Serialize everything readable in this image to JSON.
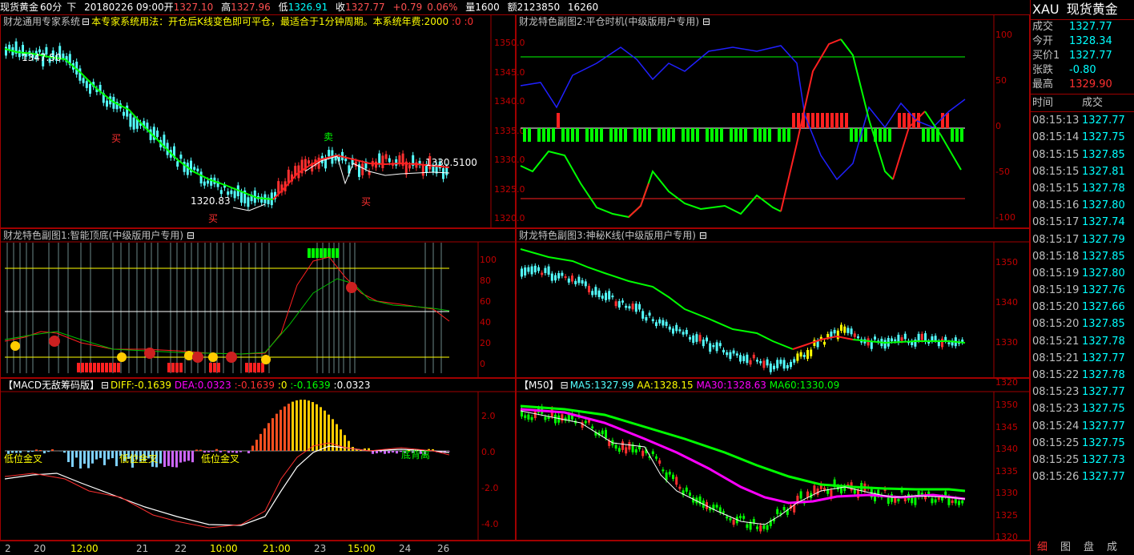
{
  "header": {
    "symbol_name": "现货黄金",
    "period": "60分",
    "direction": "下",
    "datetime": "20180226 09:00",
    "open_label": "开",
    "open": "1327.10",
    "high_label": "高",
    "high": "1327.96",
    "low_label": "低",
    "low": "1326.91",
    "close_label": "收",
    "close": "1327.77",
    "change": "+0.79",
    "change_pct": "0.06%",
    "volume_label": "量",
    "volume": "1600",
    "amount_label": "额",
    "amount": "2123850",
    "extra": "16260"
  },
  "panels": {
    "main": {
      "title": "财龙通用专家系统",
      "desc": "本专家系统用法：开仓后K线变色即可平仓，最适合于1分钟周期。本系统年费:2000",
      "tail": ":0 :0",
      "y_ticks": [
        "1350.0",
        "1345.0",
        "1340.0",
        "1335.0",
        "1330.0",
        "1325.0",
        "1320.0"
      ],
      "annotations": {
        "buy1": "买",
        "buy2": "买",
        "buy3": "买",
        "sell": "卖",
        "low_val": "1320.83",
        "hi_val": "1347.50",
        "last_val": "1330.5100"
      }
    },
    "sub1": {
      "title": "财龙特色副图1:智能顶底(中级版用户专用)",
      "y_ticks": [
        "100",
        "80",
        "60",
        "40",
        "20",
        "0"
      ]
    },
    "sub2": {
      "title": "财龙特色副图2:平仓时机(中级版用户专用)",
      "y_ticks": [
        "100",
        "50",
        "0",
        "-50",
        "-100"
      ]
    },
    "sub3": {
      "title": "财龙特色副图3:神秘K线(中级版用户专用)",
      "y_ticks": [
        "1350",
        "1340",
        "1330",
        "1320"
      ]
    },
    "macd": {
      "title": "【MACD无敌筹码版】",
      "diff_label": "DIFF:",
      "diff": "-0.1639",
      "dea_label": "DEA:",
      "dea": "0.0323",
      "v1": ":-0.1639",
      "v2": ":0",
      "v3": ":-0.1639",
      "v4": ":0.0323",
      "y_ticks": [
        "2.0",
        "0.0",
        "-2.0",
        "-4.0"
      ],
      "annotations": {
        "a1": "低位金叉",
        "a2": "低位金叉",
        "a3": "低位金叉",
        "a4": "底背离"
      }
    },
    "ma": {
      "title": "【M50】",
      "ma5": "MA5:1327.99",
      "aa": "AA:1328.15",
      "ma30": "MA30:1328.63",
      "ma60": "MA60:1330.09",
      "y_ticks": [
        "1350",
        "1345",
        "1340",
        "1335",
        "1330",
        "1325",
        "1320"
      ]
    }
  },
  "x_axis": [
    {
      "label": "2",
      "color": "#c0c0c0"
    },
    {
      "label": "20",
      "color": "#c0c0c0"
    },
    {
      "label": "12:00",
      "color": "#ffff00"
    },
    {
      "label": "21",
      "color": "#c0c0c0"
    },
    {
      "label": "22",
      "color": "#c0c0c0"
    },
    {
      "label": "10:00",
      "color": "#ffff00"
    },
    {
      "label": "21:00",
      "color": "#ffff00"
    },
    {
      "label": "23",
      "color": "#c0c0c0"
    },
    {
      "label": "15:00",
      "color": "#ffff00"
    },
    {
      "label": "24",
      "color": "#c0c0c0"
    },
    {
      "label": "26",
      "color": "#c0c0c0"
    }
  ],
  "quote": {
    "code": "XAU",
    "name": "现货黄金",
    "rows": [
      {
        "k": "成交",
        "v": "1327.77",
        "color": "#00ffff"
      },
      {
        "k": "今开",
        "v": "1328.34",
        "color": "#00ffff"
      },
      {
        "k": "买价1",
        "v": "1327.77",
        "color": "#00ffff"
      },
      {
        "k": "张跌",
        "v": "-0.80",
        "color": "#00ffff"
      },
      {
        "k": "最高",
        "v": "1329.90",
        "color": "#ff3030"
      }
    ],
    "tick_header": {
      "time": "时间",
      "price": "成交"
    },
    "ticks": [
      {
        "t": "08:15:13",
        "p": "1327.77"
      },
      {
        "t": "08:15:14",
        "p": "1327.75"
      },
      {
        "t": "08:15:15",
        "p": "1327.85"
      },
      {
        "t": "08:15:15",
        "p": "1327.81"
      },
      {
        "t": "08:15:15",
        "p": "1327.78"
      },
      {
        "t": "08:15:16",
        "p": "1327.80"
      },
      {
        "t": "08:15:17",
        "p": "1327.74"
      },
      {
        "t": "08:15:17",
        "p": "1327.79"
      },
      {
        "t": "08:15:18",
        "p": "1327.85"
      },
      {
        "t": "08:15:19",
        "p": "1327.80"
      },
      {
        "t": "08:15:19",
        "p": "1327.76"
      },
      {
        "t": "08:15:20",
        "p": "1327.66"
      },
      {
        "t": "08:15:20",
        "p": "1327.85"
      },
      {
        "t": "08:15:21",
        "p": "1327.78"
      },
      {
        "t": "08:15:21",
        "p": "1327.77"
      },
      {
        "t": "08:15:22",
        "p": "1327.78"
      },
      {
        "t": "08:15:23",
        "p": "1327.77"
      },
      {
        "t": "08:15:23",
        "p": "1327.75"
      },
      {
        "t": "08:15:24",
        "p": "1327.77"
      },
      {
        "t": "08:15:25",
        "p": "1327.75"
      },
      {
        "t": "08:15:25",
        "p": "1327.73"
      },
      {
        "t": "08:15:26",
        "p": "1327.77"
      }
    ],
    "tabs": [
      "细",
      "图",
      "盘",
      "成"
    ]
  },
  "colors": {
    "up": "#ff3030",
    "down": "#54ffff",
    "grid": "#a00000",
    "green": "#00ff00"
  }
}
